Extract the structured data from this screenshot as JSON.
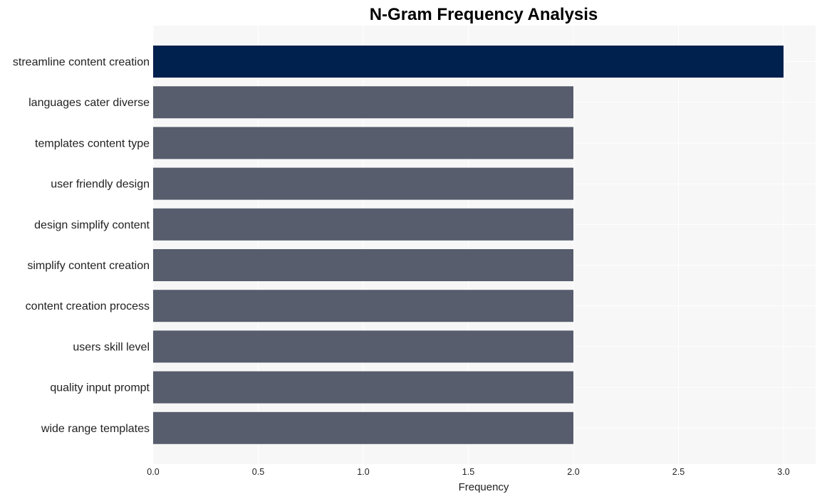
{
  "chart_data": {
    "type": "bar",
    "orientation": "horizontal",
    "title": "N-Gram Frequency Analysis",
    "xlabel": "Frequency",
    "ylabel": "",
    "xlim": [
      0,
      3.15
    ],
    "xticks": [
      0.0,
      0.5,
      1.0,
      1.5,
      2.0,
      2.5,
      3.0
    ],
    "xtick_labels": [
      "0.0",
      "0.5",
      "1.0",
      "1.5",
      "2.0",
      "2.5",
      "3.0"
    ],
    "grid": true,
    "categories": [
      "streamline content creation",
      "languages cater diverse",
      "templates content type",
      "user friendly design",
      "design simplify content",
      "simplify content creation",
      "content creation process",
      "users skill level",
      "quality input prompt",
      "wide range templates"
    ],
    "values": [
      3,
      2,
      2,
      2,
      2,
      2,
      2,
      2,
      2,
      2
    ],
    "colors": {
      "highlight": "#00204e",
      "default": "#575d6d",
      "plot_background": "#f7f7f7",
      "grid": "#ffffff"
    }
  }
}
